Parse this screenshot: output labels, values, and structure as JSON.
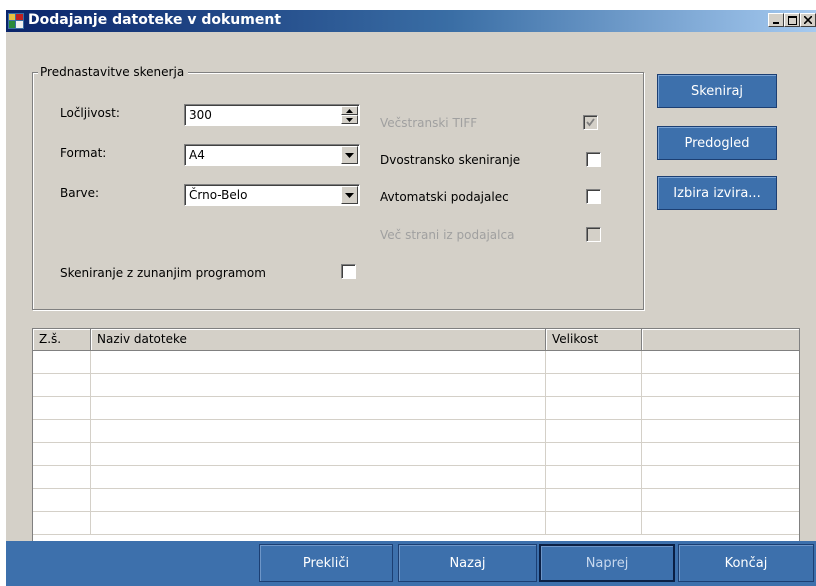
{
  "window": {
    "title": "Dodajanje datoteke v dokument",
    "controls": {
      "minimize": "_",
      "maximize": "□",
      "close": "×"
    }
  },
  "scanner_settings": {
    "group_title": "Prednastavitve skenerja",
    "resolution": {
      "label": "Ločljivost:",
      "value": "300"
    },
    "format": {
      "label": "Format:",
      "value": "A4"
    },
    "colors": {
      "label": "Barve:",
      "value": "Črno-Belo"
    },
    "external_program": {
      "label": "Skeniranje z zunanjim programom",
      "checked": false
    },
    "multipage_tiff": {
      "label": "Večstranski TIFF",
      "checked": true,
      "enabled": false
    },
    "duplex": {
      "label": "Dvostransko skeniranje",
      "checked": false
    },
    "auto_feeder": {
      "label": "Avtomatski podajalec",
      "checked": false
    },
    "multi_from_feeder": {
      "label": "Več strani iz podajalca",
      "checked": false,
      "enabled": false
    }
  },
  "side_buttons": {
    "scan": "Skeniraj",
    "preview": "Predogled",
    "select_source": "Izbira izvira..."
  },
  "file_table": {
    "columns": [
      "Z.š.",
      "Naziv datoteke",
      "Velikost",
      ""
    ],
    "rows": []
  },
  "footer": {
    "cancel": "Prekliči",
    "back": "Nazaj",
    "next": "Naprej",
    "finish": "Končaj"
  },
  "colors": {
    "accent": "#3d70ac",
    "titlebar_start": "#0a246a",
    "titlebar_end": "#a6caf0",
    "face": "#d4d0c8"
  }
}
